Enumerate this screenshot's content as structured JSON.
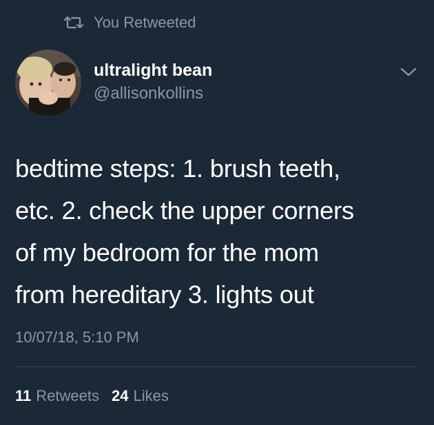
{
  "retweet_context": {
    "label": "You Retweeted",
    "icon": "retweet-icon"
  },
  "author": {
    "display_name": "ultralight bean",
    "handle": "@allisonkollins",
    "avatar": "avatar-photo"
  },
  "tweet": {
    "lines": [
      "bedtime steps: 1. brush teeth,",
      "etc. 2. check the upper corners",
      "of my bedroom for the mom",
      "from hereditary 3. lights out"
    ],
    "timestamp": "10/07/18, 5:10 PM"
  },
  "stats": {
    "retweets_count": "11",
    "retweets_label": "Retweets",
    "likes_count": "24",
    "likes_label": "Likes"
  },
  "menu": {
    "icon": "chevron-down-icon"
  },
  "colors": {
    "background": "#1b2836",
    "secondary_text": "#8899a6",
    "primary_text": "#ffffff",
    "divider": "#38444d"
  }
}
